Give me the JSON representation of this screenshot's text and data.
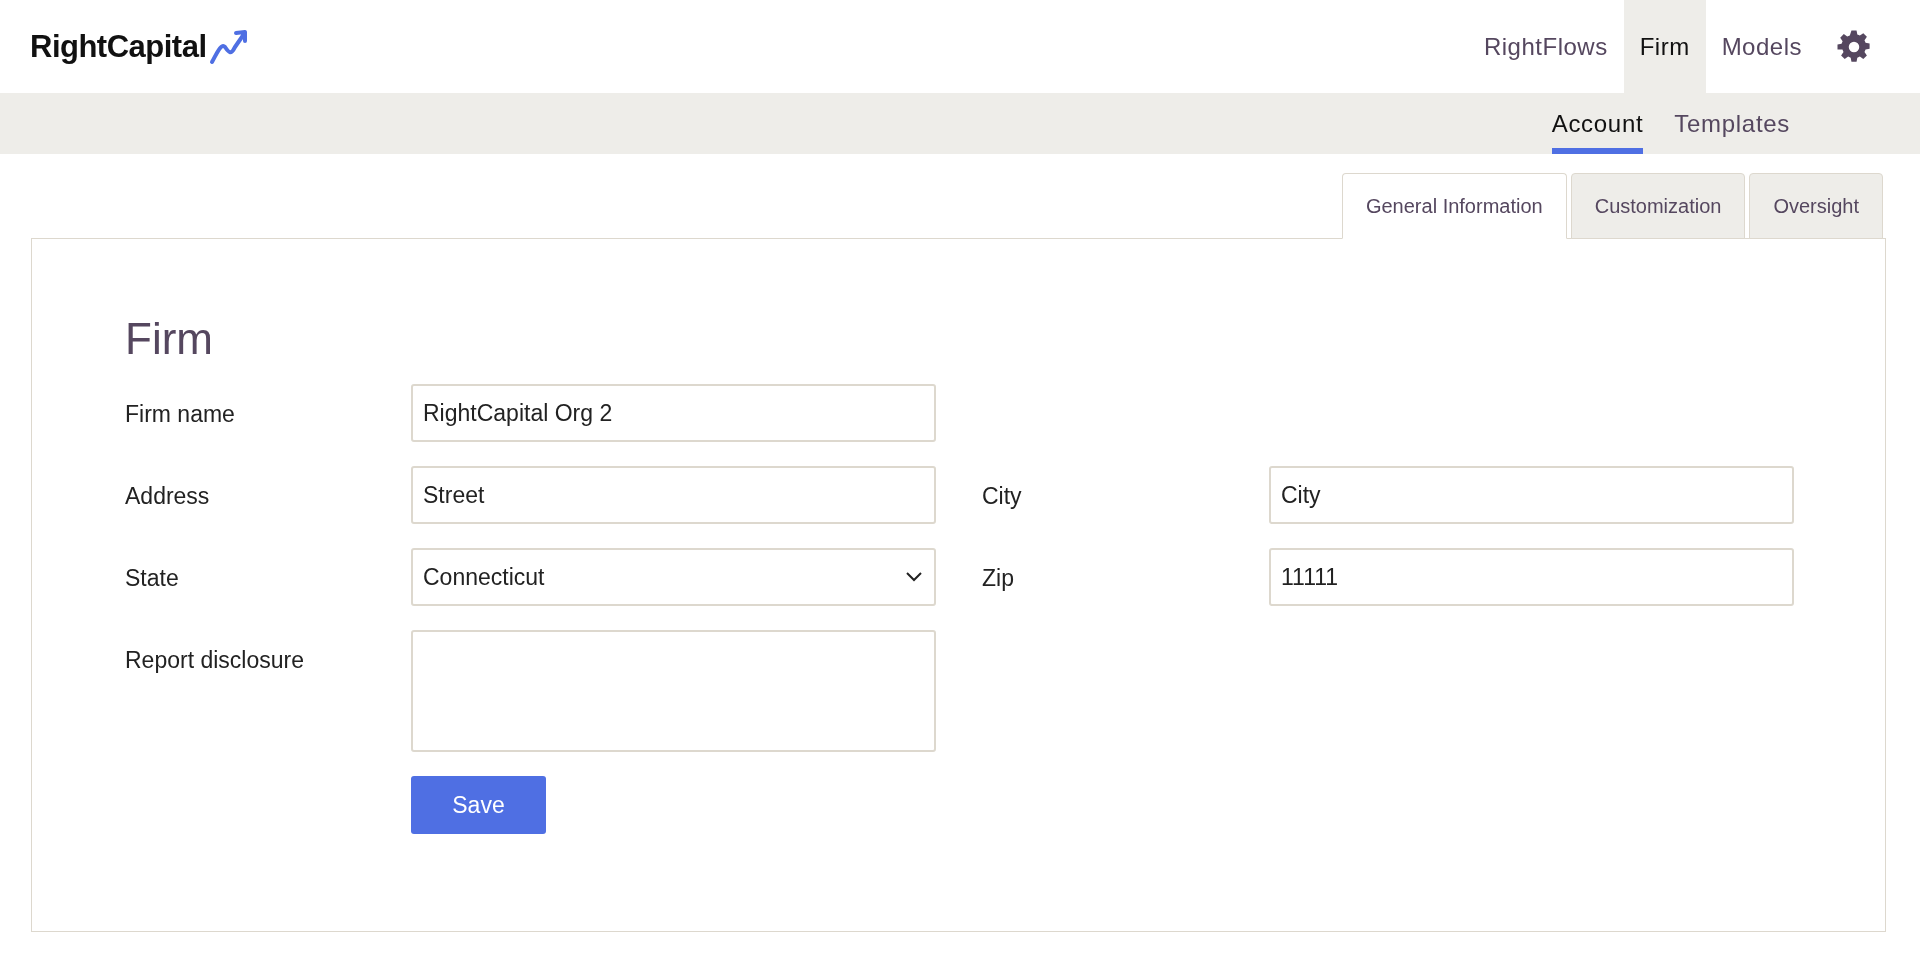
{
  "logo": {
    "text": "RightCapital"
  },
  "top_nav": [
    {
      "label": "RightFlows",
      "selected": false
    },
    {
      "label": "Firm",
      "selected": true
    },
    {
      "label": "Models",
      "selected": false
    }
  ],
  "sub_nav": [
    {
      "label": "Account",
      "selected": true
    },
    {
      "label": "Templates",
      "selected": false
    }
  ],
  "tabs": [
    {
      "label": "General Information",
      "selected": true
    },
    {
      "label": "Customization",
      "selected": false
    },
    {
      "label": "Oversight",
      "selected": false
    }
  ],
  "form": {
    "title": "Firm",
    "rows": [
      {
        "fields": [
          {
            "label": "Firm name",
            "kind": "text",
            "value": "RightCapital Org 2"
          }
        ]
      },
      {
        "fields": [
          {
            "label": "Address",
            "kind": "text",
            "value": "Street"
          },
          {
            "label": "City",
            "kind": "text",
            "value": "City"
          }
        ]
      },
      {
        "fields": [
          {
            "label": "State",
            "kind": "select",
            "value": "Connecticut"
          },
          {
            "label": "Zip",
            "kind": "text",
            "value": "11111"
          }
        ]
      },
      {
        "fields": [
          {
            "label": "Report disclosure",
            "kind": "textarea"
          }
        ]
      }
    ],
    "save_button": "Save"
  }
}
